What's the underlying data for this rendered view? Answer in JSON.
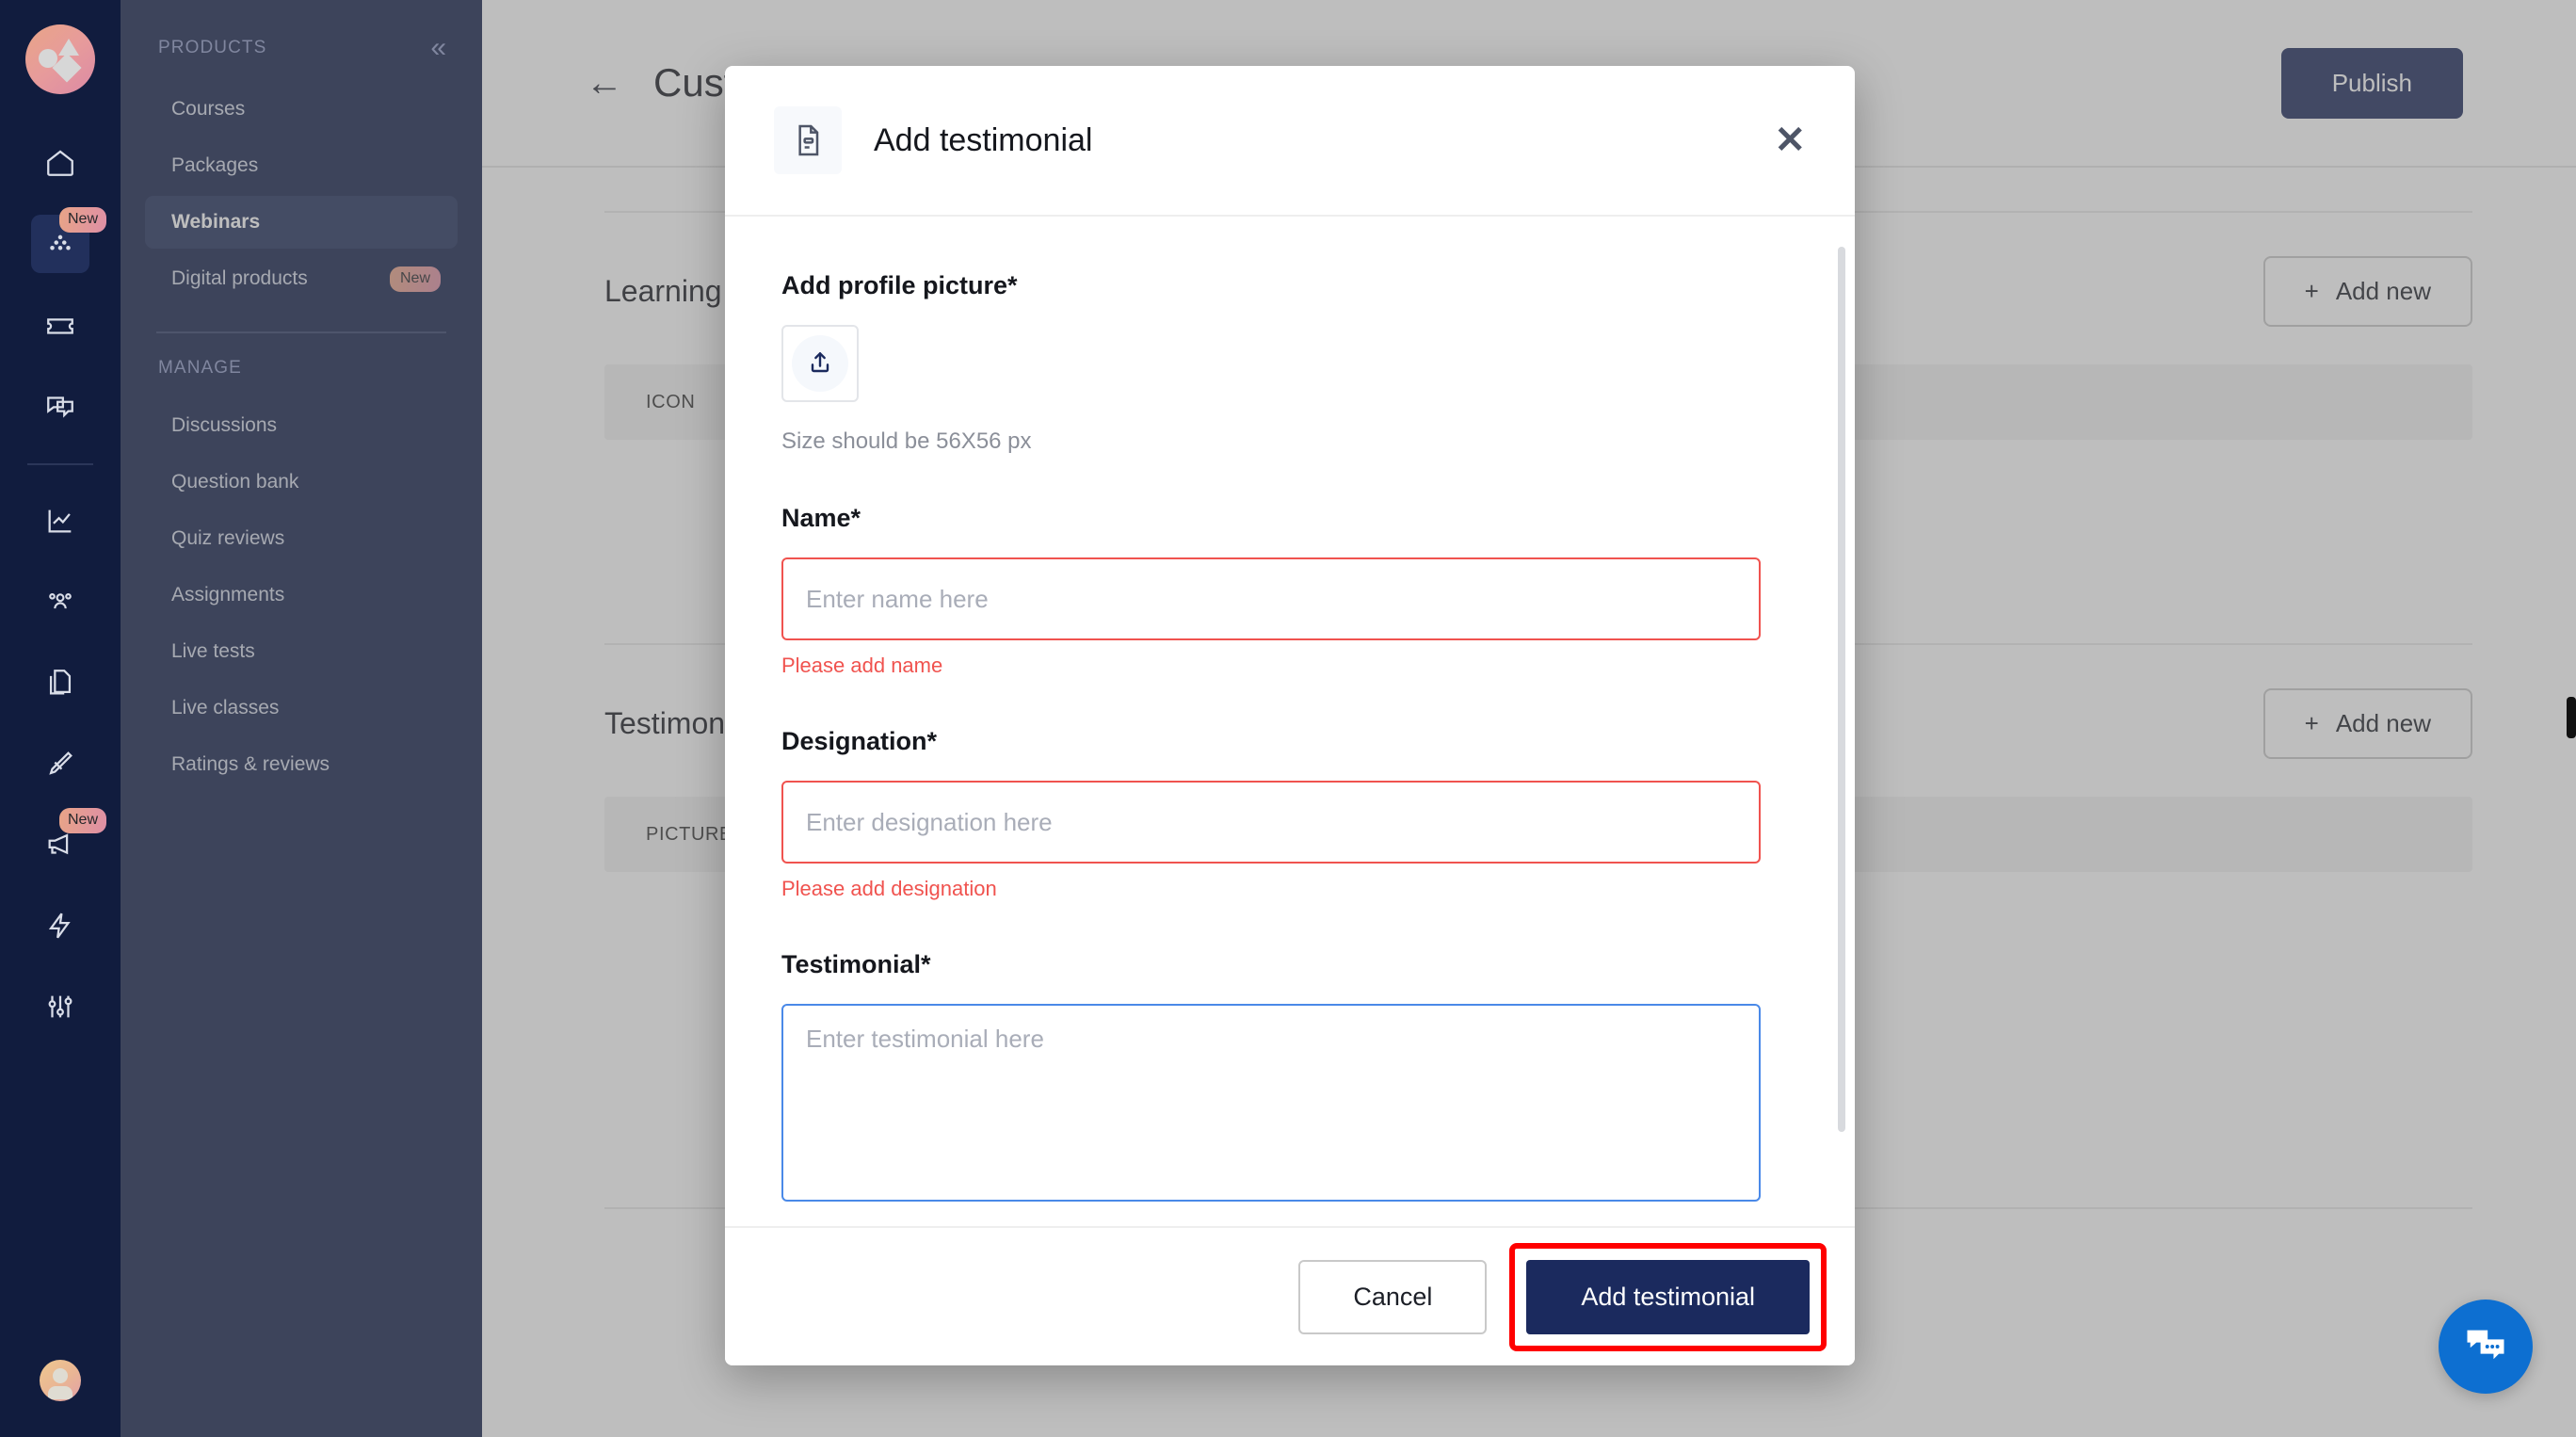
{
  "sidebar": {
    "rail": {
      "logo_name": "brand-logo",
      "items": [
        {
          "icon": "home-icon",
          "badge": null,
          "active": false
        },
        {
          "icon": "products-icon",
          "badge": "New",
          "active": true
        },
        {
          "icon": "coupon-icon",
          "badge": null,
          "active": false
        },
        {
          "icon": "chat-icon",
          "badge": null,
          "active": false
        },
        {
          "icon": "analytics-icon",
          "badge": null,
          "active": false
        },
        {
          "icon": "learners-icon",
          "badge": null,
          "active": false
        },
        {
          "icon": "pages-icon",
          "badge": null,
          "active": false
        },
        {
          "icon": "design-icon",
          "badge": null,
          "active": false
        },
        {
          "icon": "marketing-icon",
          "badge": "New",
          "active": false
        },
        {
          "icon": "automation-icon",
          "badge": null,
          "active": false
        },
        {
          "icon": "settings-icon",
          "badge": null,
          "active": false
        }
      ],
      "avatar_name": "user-avatar"
    },
    "products_label": "PRODUCTS",
    "collapse_icon": "«",
    "products_items": [
      {
        "label": "Courses",
        "badge": null,
        "active": false
      },
      {
        "label": "Packages",
        "badge": null,
        "active": false
      },
      {
        "label": "Webinars",
        "badge": null,
        "active": true
      },
      {
        "label": "Digital products",
        "badge": "New",
        "active": false
      }
    ],
    "manage_label": "MANAGE",
    "manage_items": [
      {
        "label": "Discussions",
        "badge": null,
        "active": false
      },
      {
        "label": "Question bank",
        "badge": null,
        "active": false
      },
      {
        "label": "Quiz reviews",
        "badge": null,
        "active": false
      },
      {
        "label": "Assignments",
        "badge": null,
        "active": false
      },
      {
        "label": "Live tests",
        "badge": null,
        "active": false
      },
      {
        "label": "Live classes",
        "badge": null,
        "active": false
      },
      {
        "label": "Ratings & reviews",
        "badge": null,
        "active": false
      }
    ]
  },
  "topbar": {
    "back_icon": "←",
    "page_title": "Customize widget",
    "publish_label": "Publish"
  },
  "background_sections": [
    {
      "title": "Learning outcomes",
      "add_new_label": "Add new",
      "column_header": "ICON"
    },
    {
      "title": "Testimonials",
      "add_new_label": "Add new",
      "column_header": "PICTURE"
    }
  ],
  "modal": {
    "icon": "document-icon",
    "title": "Add testimonial",
    "close_icon": "✕",
    "profile_picture": {
      "label": "Add profile picture*",
      "upload_icon": "upload-icon",
      "hint": "Size should be 56X56 px"
    },
    "name_field": {
      "label": "Name*",
      "placeholder": "Enter name here",
      "value": "",
      "error": "Please add name",
      "state": "error"
    },
    "designation_field": {
      "label": "Designation*",
      "placeholder": "Enter designation here",
      "value": "",
      "error": "Please add designation",
      "state": "error"
    },
    "testimonial_field": {
      "label": "Testimonial*",
      "placeholder": "Enter testimonial here",
      "value": "",
      "state": "focused"
    },
    "footer": {
      "cancel_label": "Cancel",
      "submit_label": "Add testimonial",
      "submit_highlighted": true
    }
  },
  "chat_widget": {
    "icon": "chat-bubbles-icon"
  },
  "colors": {
    "rail_bg": "#111c3e",
    "subnav_bg": "#15224b",
    "nav_active": "#22305c",
    "primary": "#1b2a5e",
    "error": "#f0534f",
    "focus_border": "#4a89e8",
    "highlight": "#ff0000",
    "chat_blue": "#0d6fd1",
    "badge_gradient_from": "#e8a487",
    "badge_gradient_to": "#de8fa6"
  }
}
